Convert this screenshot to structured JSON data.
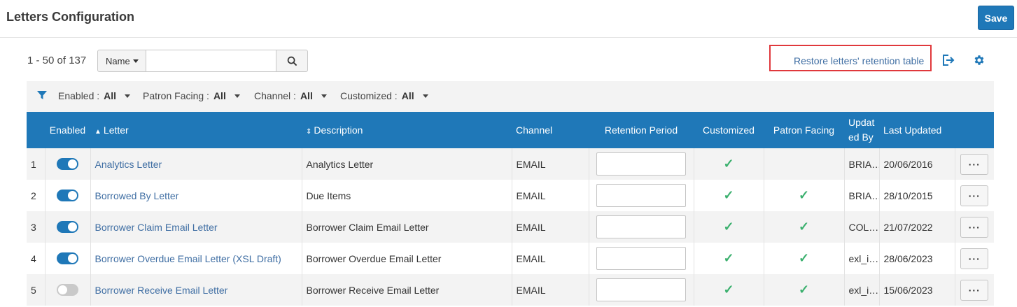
{
  "header": {
    "title": "Letters Configuration",
    "save_label": "Save"
  },
  "toolbar": {
    "count": "1 - 50 of 137",
    "search_field": "Name",
    "search_value": "",
    "restore_link": "Restore letters' retention table"
  },
  "filters": [
    {
      "label": "Enabled :",
      "value": "All"
    },
    {
      "label": "Patron Facing :",
      "value": "All"
    },
    {
      "label": "Channel :",
      "value": "All"
    },
    {
      "label": "Customized :",
      "value": "All"
    }
  ],
  "table": {
    "columns": [
      "",
      "Enabled",
      "Letter",
      "Description",
      "Channel",
      "Retention Period",
      "Customized",
      "Patron Facing",
      "Updat ed By",
      "Last Updated",
      ""
    ],
    "sort": {
      "letter": "▲",
      "description": "⇕"
    },
    "rows": [
      {
        "num": "1",
        "enabled": true,
        "letter": "Analytics Letter",
        "description": "Analytics Letter",
        "channel": "EMAIL",
        "retention": "",
        "customized": true,
        "patron_facing": false,
        "updated_by": "BRIA…",
        "last_updated": "20/06/2016",
        "actions": "···"
      },
      {
        "num": "2",
        "enabled": true,
        "letter": "Borrowed By Letter",
        "description": "Due Items",
        "channel": "EMAIL",
        "retention": "",
        "customized": true,
        "patron_facing": true,
        "updated_by": "BRIA…",
        "last_updated": "28/10/2015",
        "actions": "···"
      },
      {
        "num": "3",
        "enabled": true,
        "letter": "Borrower Claim Email Letter",
        "description": "Borrower Claim Email Letter",
        "channel": "EMAIL",
        "retention": "",
        "customized": true,
        "patron_facing": true,
        "updated_by": "COL…",
        "last_updated": "21/07/2022",
        "actions": "···"
      },
      {
        "num": "4",
        "enabled": true,
        "letter": "Borrower Overdue Email Letter (XSL Draft)",
        "description": "Borrower Overdue Email Letter",
        "channel": "EMAIL",
        "retention": "",
        "customized": true,
        "patron_facing": true,
        "updated_by": "exl_i…",
        "last_updated": "28/06/2023",
        "actions": "···"
      },
      {
        "num": "5",
        "enabled": false,
        "letter": "Borrower Receive Email Letter",
        "description": "Borrower Receive Email Letter",
        "channel": "EMAIL",
        "retention": "",
        "customized": true,
        "patron_facing": true,
        "updated_by": "exl_i…",
        "last_updated": "15/06/2023",
        "actions": "···"
      }
    ]
  },
  "icons": {
    "search": "search-icon",
    "export": "export-icon",
    "settings": "gear-icon",
    "filter": "filter-icon",
    "check": "✓"
  },
  "colors": {
    "accent": "#1f78b8",
    "link": "#3f6ea3",
    "check": "#3bb06e",
    "highlight_box": "#e0383c"
  }
}
